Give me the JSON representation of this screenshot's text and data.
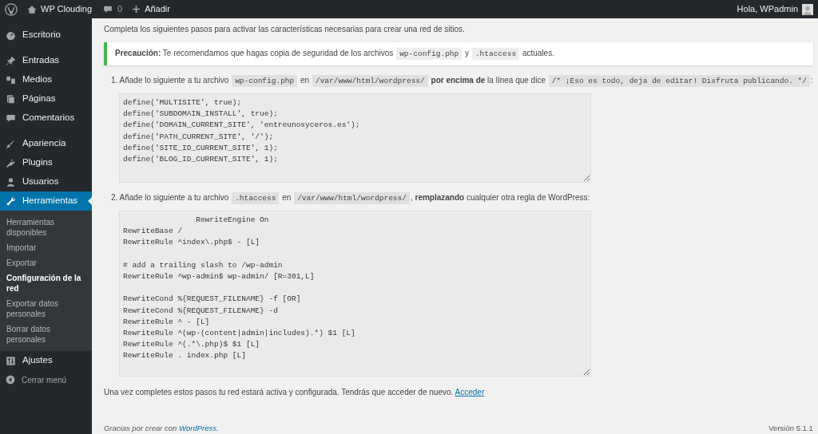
{
  "admin_bar": {
    "site_name": "WP Clouding",
    "comments_count": "0",
    "new_label": "Añadir",
    "greeting": "Hola, WPadmin"
  },
  "sidebar": {
    "groups": [
      [
        {
          "label": "Escritorio",
          "selected": false
        }
      ],
      [
        {
          "label": "Entradas",
          "selected": false
        },
        {
          "label": "Medios",
          "selected": false
        },
        {
          "label": "Páginas",
          "selected": false
        },
        {
          "label": "Comentarios",
          "selected": false
        }
      ],
      [
        {
          "label": "Apariencia",
          "selected": false
        },
        {
          "label": "Plugins",
          "selected": false
        },
        {
          "label": "Usuarios",
          "selected": false
        },
        {
          "label": "Herramientas",
          "selected": true,
          "submenu": [
            {
              "label": "Herramientas disponibles",
              "selected": false
            },
            {
              "label": "Importar",
              "selected": false
            },
            {
              "label": "Exportar",
              "selected": false
            },
            {
              "label": "Configuración de la red",
              "selected": true
            },
            {
              "label": "Exportar datos personales",
              "selected": false
            },
            {
              "label": "Borrar datos personales",
              "selected": false
            }
          ]
        },
        {
          "label": "Ajustes",
          "selected": false
        }
      ]
    ],
    "collapse_label": "Cerrar menú"
  },
  "intro": "Completa los siguientes pasos para activar las características necesarias para crear una red de sitios.",
  "notice": [
    {
      "kind": "bold",
      "text": "Precaución:"
    },
    {
      "kind": "text",
      "text": " Te recomendamos que hagas copia de seguridad de los archivos "
    },
    {
      "kind": "code",
      "text": "wp-config.php"
    },
    {
      "kind": "text",
      "text": " y "
    },
    {
      "kind": "code",
      "text": ".htaccess"
    },
    {
      "kind": "text",
      "text": " actuales."
    }
  ],
  "steps": [
    {
      "number": "1.",
      "text": [
        {
          "kind": "text",
          "text": "Añade lo siguiente a tu archivo "
        },
        {
          "kind": "code",
          "text": "wp-config.php"
        },
        {
          "kind": "text",
          "text": " en "
        },
        {
          "kind": "code",
          "text": "/var/www/html/wordpress/"
        },
        {
          "kind": "bold",
          "text": " por encima de"
        },
        {
          "kind": "text",
          "text": " la línea que dice "
        },
        {
          "kind": "code",
          "text": "/* ¡Eso es todo, deja de editar! Disfruta publicando. */"
        },
        {
          "kind": "text",
          "text": ":"
        }
      ],
      "code": "define('MULTISITE', true);\ndefine('SUBDOMAIN_INSTALL', true);\ndefine('DOMAIN_CURRENT_SITE', 'entreunosyceros.es');\ndefine('PATH_CURRENT_SITE', '/');\ndefine('SITE_ID_CURRENT_SITE', 1);\ndefine('BLOG_ID_CURRENT_SITE', 1);"
    },
    {
      "number": "2.",
      "text": [
        {
          "kind": "text",
          "text": "Añade lo siguiente a tu archivo "
        },
        {
          "kind": "code",
          "text": ".htaccess"
        },
        {
          "kind": "text",
          "text": " en "
        },
        {
          "kind": "code",
          "text": "/var/www/html/wordpress/"
        },
        {
          "kind": "text",
          "text": ", "
        },
        {
          "kind": "bold",
          "text": "remplazando"
        },
        {
          "kind": "text",
          "text": " cualquier otra regla de WordPress:"
        }
      ],
      "code": "                RewriteEngine On\nRewriteBase /\nRewriteRule ^index\\.php$ - [L]\n\n# add a trailing slash to /wp-admin\nRewriteRule ^wp-admin$ wp-admin/ [R=301,L]\n\nRewriteCond %{REQUEST_FILENAME} -f [OR]\nRewriteCond %{REQUEST_FILENAME} -d\nRewriteRule ^ - [L]\nRewriteRule ^(wp-(content|admin|includes).*) $1 [L]\nRewriteRule ^(.*\\.php)$ $1 [L]\nRewriteRule . index.php [L]"
    }
  ],
  "outro": "Una vez completes estos pasos tu red estará activa y configurada. Tendrás que acceder de nuevo.",
  "outro_link": "Acceder",
  "footer": {
    "text": "Gracias por crear con",
    "link": "WordPress",
    "link_end": ".",
    "version": "Versión 5.1.1"
  }
}
